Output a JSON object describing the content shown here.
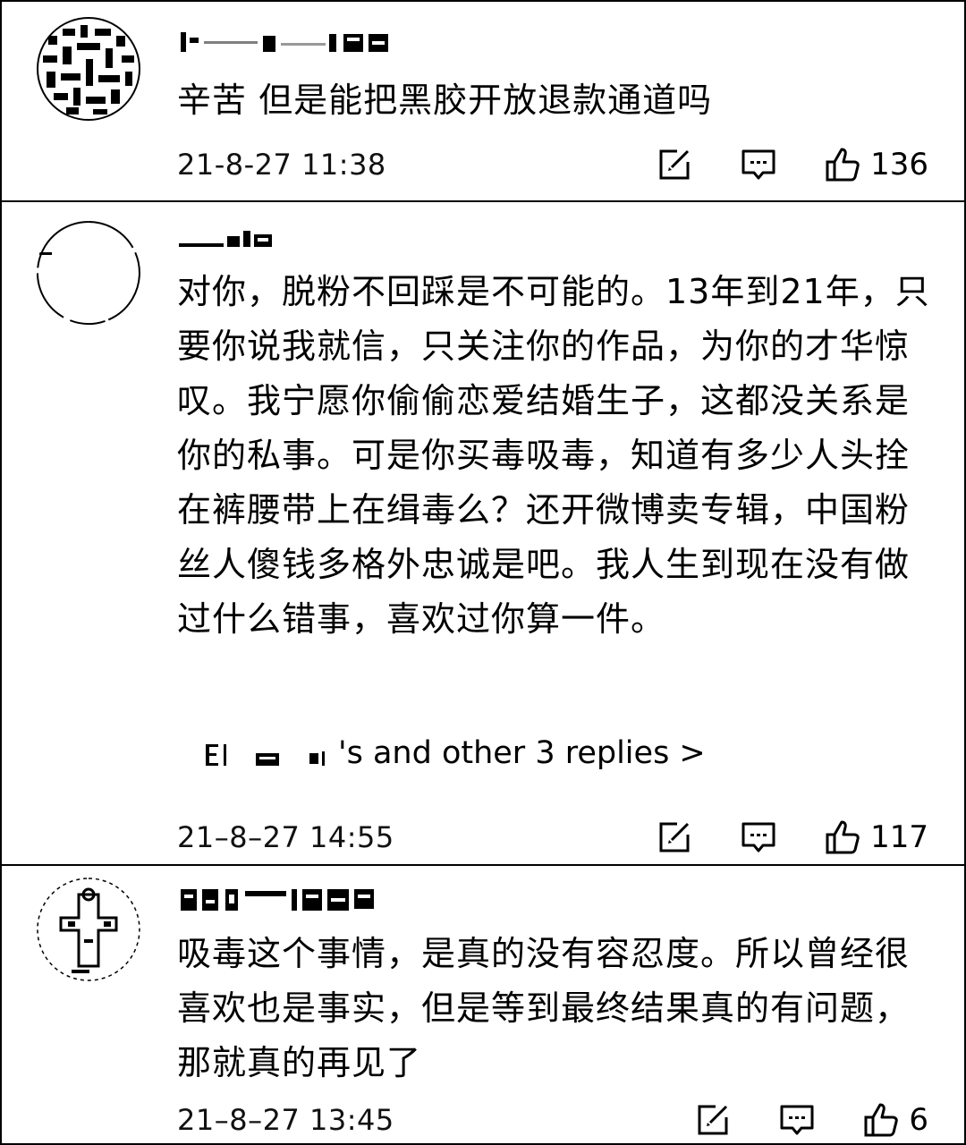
{
  "comments": [
    {
      "avatar_icon": "user-avatar-icon",
      "text": "辛苦 但是能把黑胶开放退款通道吗",
      "timestamp": "21-8-27 11:38",
      "likes": "136"
    },
    {
      "avatar_icon": "user-avatar-icon",
      "text": "对你，脱粉不回踩是不可能的。13年到21年，只要你说我就信，只关注你的作品，为你的才华惊叹。我宁愿你偷偷恋爱结婚生子，这都没关系是你的私事。可是你买毒吸毒，知道有多少人头拴在裤腰带上在缉毒么？还开微博卖专辑，中国粉丝人傻钱多格外忠诚是吧。我人生到现在没有做过什么错事，喜欢过你算一件。",
      "replies_label": "'s and other 3 replies >",
      "timestamp": "21–8–27 14:55",
      "likes": "117"
    },
    {
      "avatar_icon": "user-avatar-icon",
      "text": "吸毒这个事情，是真的没有容忍度。所以曾经很喜欢也是事实，但是等到最终结果真的有问题，那就真的再见了",
      "timestamp": "21–8–27 13:45",
      "likes": "6"
    }
  ],
  "icons": {
    "edit": "edit-icon",
    "comment": "comment-icon",
    "like": "thumbs-up-icon"
  }
}
